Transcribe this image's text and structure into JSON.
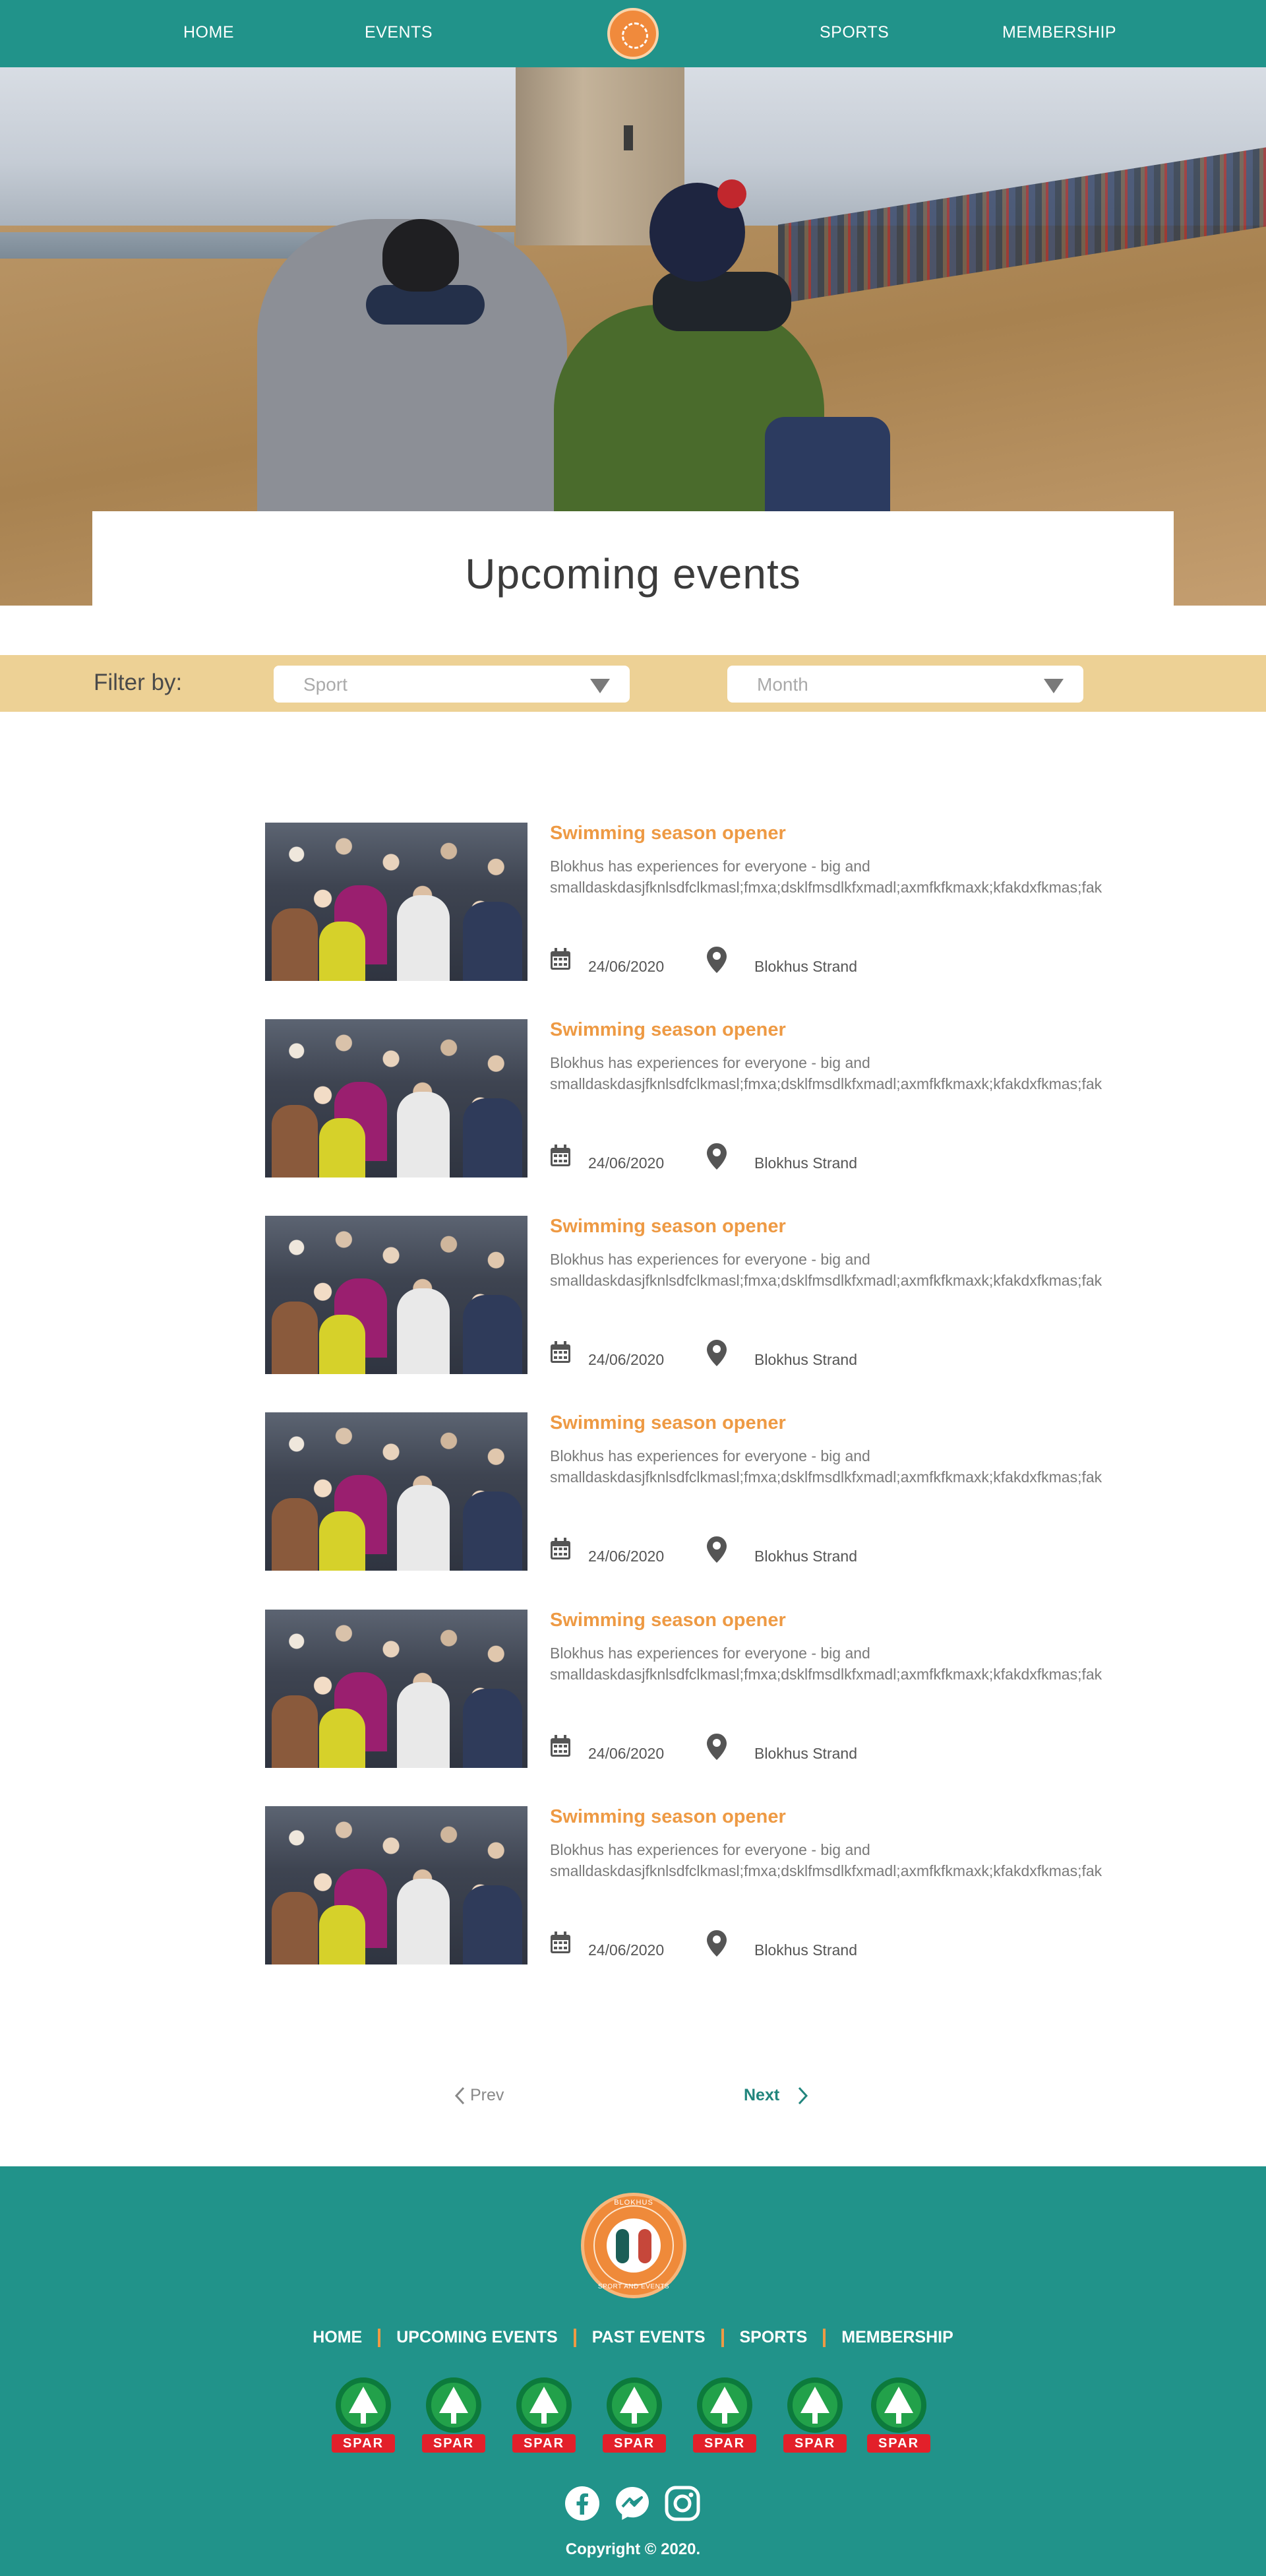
{
  "nav": {
    "items": [
      "HOME",
      "EVENTS",
      "SPORTS",
      "MEMBERSHIP"
    ]
  },
  "hero": {
    "title": "Upcoming events"
  },
  "filter": {
    "label": "Filter by:",
    "sport_placeholder": "Sport",
    "month_placeholder": "Month"
  },
  "events": [
    {
      "title": "Swimming season opener",
      "description": "Blokhus has experiences for everyone - big and smalldaskdasjfknlsdfclkmasl;fmxa;dsklfmsdlkfxmadl;axmfkfkmaxk;kfakdxfkmas;fak",
      "date": "24/06/2020",
      "location": "Blokhus Strand"
    },
    {
      "title": "Swimming season opener",
      "description": "Blokhus has experiences for everyone - big and smalldaskdasjfknlsdfclkmasl;fmxa;dsklfmsdlkfxmadl;axmfkfkmaxk;kfakdxfkmas;fak",
      "date": "24/06/2020",
      "location": "Blokhus Strand"
    },
    {
      "title": "Swimming season opener",
      "description": "Blokhus has experiences for everyone - big and smalldaskdasjfknlsdfclkmasl;fmxa;dsklfmsdlkfxmadl;axmfkfkmaxk;kfakdxfkmas;fak",
      "date": "24/06/2020",
      "location": "Blokhus Strand"
    },
    {
      "title": "Swimming season opener",
      "description": "Blokhus has experiences for everyone - big and smalldaskdasjfknlsdfclkmasl;fmxa;dsklfmsdlkfxmadl;axmfkfkmaxk;kfakdxfkmas;fak",
      "date": "24/06/2020",
      "location": "Blokhus Strand"
    },
    {
      "title": "Swimming season opener",
      "description": "Blokhus has experiences for everyone - big and smalldaskdasjfknlsdfclkmasl;fmxa;dsklfmsdlkfxmadl;axmfkfkmaxk;kfakdxfkmas;fak",
      "date": "24/06/2020",
      "location": "Blokhus Strand"
    },
    {
      "title": "Swimming season opener",
      "description": "Blokhus has experiences for everyone - big and smalldaskdasjfknlsdfclkmasl;fmxa;dsklfmsdlkfxmadl;axmfkfkmaxk;kfakdxfkmas;fak",
      "date": "24/06/2020",
      "location": "Blokhus Strand"
    }
  ],
  "pagination": {
    "prev": "Prev",
    "next": "Next"
  },
  "footer": {
    "logo_top": "BLOKHUS",
    "logo_bottom": "SPORT AND EVENTS",
    "links": [
      "HOME",
      "UPCOMING EVENTS",
      "PAST EVENTS",
      "SPORTS",
      "MEMBERSHIP"
    ],
    "sponsor_name": "SPAR",
    "social_icons": [
      "facebook-icon",
      "messenger-icon",
      "instagram-icon"
    ],
    "copyright": "Copyright © 2020."
  },
  "colors": {
    "teal": "#21938a",
    "orange": "#ee9a44",
    "filter_bar": "#edd195"
  }
}
